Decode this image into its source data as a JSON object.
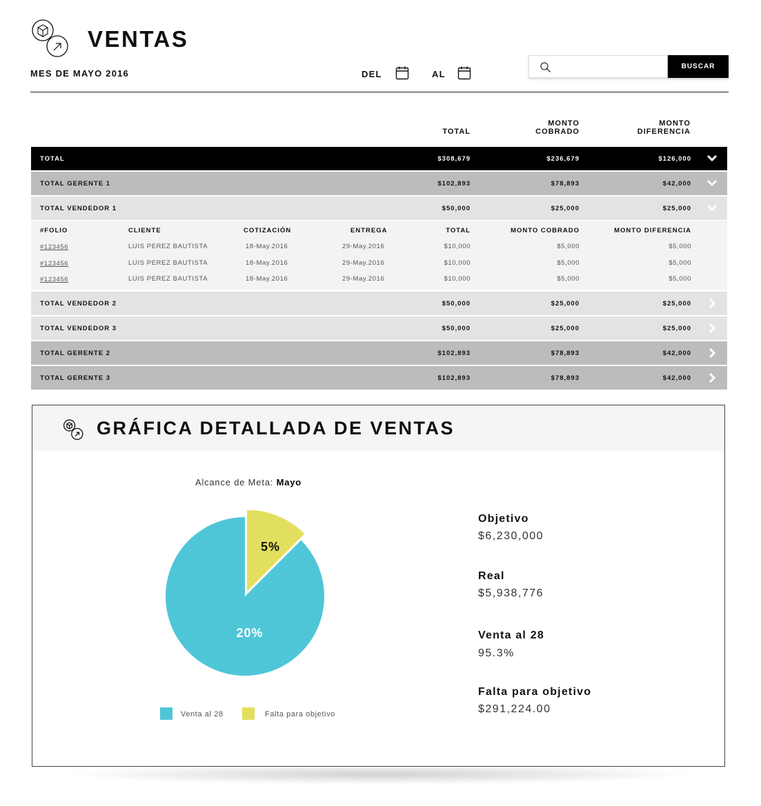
{
  "header": {
    "title": "VENTAS",
    "subtitle": "MES DE MAYO 2016",
    "from_label": "DEL",
    "to_label": "AL",
    "search_placeholder": "",
    "search_button": "BUSCAR"
  },
  "columns": {
    "total": "TOTAL",
    "cobrado_1": "MONTO",
    "cobrado_2": "COBRADO",
    "dif_1": "MONTO",
    "dif_2": "DIFERENCIA"
  },
  "rows": [
    {
      "label": "TOTAL",
      "total": "$308,679",
      "cobrado": "$236,679",
      "diferencia": "$126,000",
      "chevron": "chevron-down-icon"
    },
    {
      "label": "TOTAL GERENTE 1",
      "total": "$102,893",
      "cobrado": "$78,893",
      "diferencia": "$42,000",
      "chevron": "chevron-down-icon"
    },
    {
      "label": "TOTAL VENDEDOR 1",
      "total": "$50,000",
      "cobrado": "$25,000",
      "diferencia": "$25,000",
      "chevron": "chevron-down-icon"
    },
    {
      "label": "TOTAL VENDEDOR 2",
      "total": "$50,000",
      "cobrado": "$25,000",
      "diferencia": "$25,000",
      "chevron": "chevron-right-icon"
    },
    {
      "label": "TOTAL VENDEDOR 3",
      "total": "$50,000",
      "cobrado": "$25,000",
      "diferencia": "$25,000",
      "chevron": "chevron-right-icon"
    },
    {
      "label": "TOTAL GERENTE 2",
      "total": "$102,893",
      "cobrado": "$78,893",
      "diferencia": "$42,000",
      "chevron": "chevron-right-icon"
    },
    {
      "label": "TOTAL GERENTE 3",
      "total": "$102,893",
      "cobrado": "$78,893",
      "diferencia": "$42,000",
      "chevron": "chevron-right-icon"
    }
  ],
  "detail": {
    "headers": {
      "folio": "#FOLIO",
      "cliente": "CLIENTE",
      "cotizacion": "COTIZACIÓN",
      "entrega": "ENTREGA",
      "total": "TOTAL",
      "cobrado": "MONTO COBRADO",
      "diferencia": "MONTO DIFERENCIA"
    },
    "items": [
      {
        "folio": "#123456",
        "cliente": "LUIS PEREZ BAUTISTA",
        "cotizacion": "18-May.2016",
        "entrega": "29-May.2016",
        "total": "$10,000",
        "cobrado": "$5,000",
        "diferencia": "$5,000"
      },
      {
        "folio": "#123456",
        "cliente": "LUIS PEREZ BAUTISTA",
        "cotizacion": "18-May.2016",
        "entrega": "29-May.2016",
        "total": "$10,000",
        "cobrado": "$5,000",
        "diferencia": "$5,000"
      },
      {
        "folio": "#123456",
        "cliente": "LUIS PEREZ BAUTISTA",
        "cotizacion": "18-May.2016",
        "entrega": "29-May.2016",
        "total": "$10,000",
        "cobrado": "$5,000",
        "diferencia": "$5,000"
      }
    ]
  },
  "card": {
    "title": "GRÁFICA DETALLADA DE VENTAS",
    "caption_prefix": "Alcance de Meta:",
    "caption_month": "Mayo",
    "stats": [
      {
        "label": "Objetivo",
        "value": "$6,230,000"
      },
      {
        "label": "Real",
        "value": "$5,938,776"
      },
      {
        "label": "Venta al 28",
        "value": "95.3%"
      },
      {
        "label": "Falta para objetivo",
        "value": "$291,224.00"
      }
    ]
  },
  "colors": {
    "cyan": "#4fc6d8",
    "yellow": "#e3df5e",
    "black": "#000000",
    "row_dark": "#bcbcbc",
    "row_light": "#e3e3e3"
  },
  "chart_data": {
    "type": "pie",
    "series": [
      {
        "name": "Venta al 28",
        "label": "20%",
        "color": "#4fc6d8"
      },
      {
        "name": "Falta para objetivo",
        "label": "5%",
        "color": "#e3df5e"
      }
    ],
    "legend": "bottom"
  }
}
